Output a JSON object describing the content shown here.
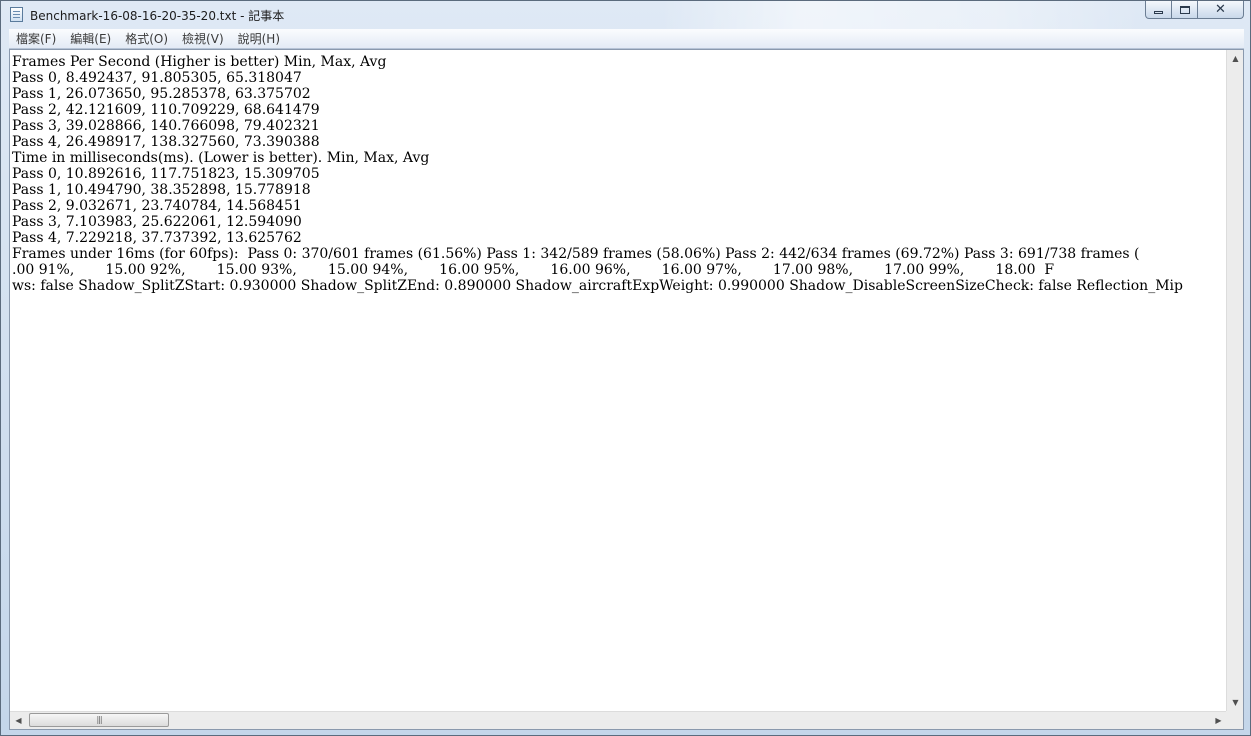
{
  "window": {
    "title": "Benchmark-16-08-16-20-35-20.txt - 記事本",
    "icon": "notepad-icon",
    "controls": {
      "minimize": "minimize-icon",
      "maximize": "maximize-icon",
      "close": "close-icon"
    }
  },
  "menu": [
    {
      "label": "檔案(F)"
    },
    {
      "label": "編輯(E)"
    },
    {
      "label": "格式(O)"
    },
    {
      "label": "檢視(V)"
    },
    {
      "label": "說明(H)"
    }
  ],
  "document": {
    "lines": [
      "Frames Per Second (Higher is better) Min, Max, Avg",
      "Pass 0, 8.492437, 91.805305, 65.318047",
      "Pass 1, 26.073650, 95.285378, 63.375702",
      "Pass 2, 42.121609, 110.709229, 68.641479",
      "Pass 3, 39.028866, 140.766098, 79.402321",
      "Pass 4, 26.498917, 138.327560, 73.390388",
      "Time in milliseconds(ms). (Lower is better). Min, Max, Avg",
      "Pass 0, 10.892616, 117.751823, 15.309705",
      "Pass 1, 10.494790, 38.352898, 15.778918",
      "Pass 2, 9.032671, 23.740784, 14.568451",
      "Pass 3, 7.103983, 25.622061, 12.594090",
      "Pass 4, 7.229218, 37.737392, 13.625762",
      "Frames under 16ms (for 60fps):  Pass 0: 370/601 frames (61.56%) Pass 1: 342/589 frames (58.06%) Pass 2: 442/634 frames (69.72%) Pass 3: 691/738 frames (",
      ".00 91%,       15.00 92%,       15.00 93%,       15.00 94%,       16.00 95%,       16.00 96%,       16.00 97%,       17.00 98%,       17.00 99%,       18.00  F",
      "ws: false Shadow_SplitZStart: 0.930000 Shadow_SplitZEnd: 0.890000 Shadow_aircraftExpWeight: 0.990000 Shadow_DisableScreenSizeCheck: false Reflection_Mip"
    ]
  },
  "scrollbars": {
    "up": "▲",
    "down": "▼",
    "left": "◀",
    "right": "▶",
    "grip": "|||"
  }
}
